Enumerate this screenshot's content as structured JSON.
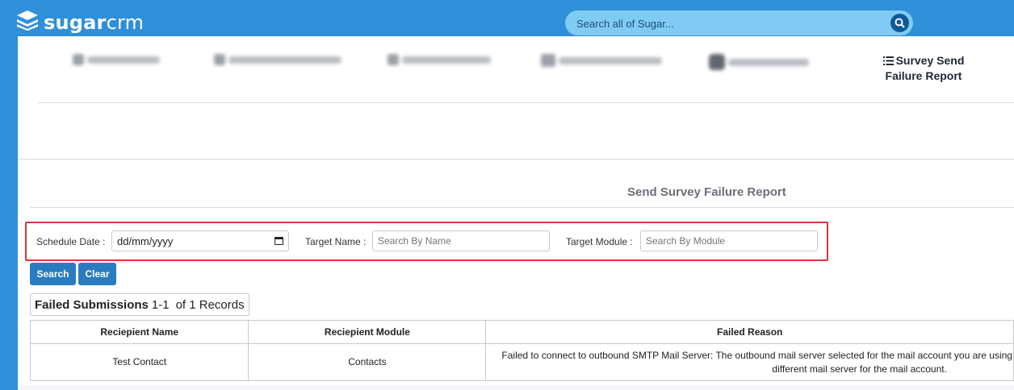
{
  "brand": {
    "bold": "sugar",
    "light": "crm"
  },
  "global_search": {
    "placeholder": "Search all of Sugar..."
  },
  "tabs": {
    "active": "Survey Send Failure Report"
  },
  "report": {
    "title": "Send Survey Failure Report"
  },
  "filters": {
    "schedule_date_label": "Schedule Date :",
    "schedule_date_placeholder": "dd/mm/yyyy",
    "target_name_label": "Target Name :",
    "target_name_placeholder": "Search By Name",
    "target_module_label": "Target Module :",
    "target_module_placeholder": "Search By Module"
  },
  "buttons": {
    "search": "Search",
    "clear": "Clear"
  },
  "summary": {
    "title": "Failed Submissions",
    "range": "1-1",
    "of_text": "of 1 Records"
  },
  "table": {
    "headers": [
      "Reciepient Name",
      "Reciepient Module",
      "Failed Reason"
    ],
    "rows": [
      {
        "name": "Test Contact",
        "module": "Contacts",
        "reason_line1": "Failed to connect to outbound SMTP Mail Server: The outbound mail server selected for the mail account you are using",
        "reason_line2": "different mail server for the mail account."
      }
    ]
  },
  "colors": {
    "header": "#2f8fd8",
    "button": "#2a7cc1",
    "highlight": "#e0333c"
  },
  "icons": {
    "search": "search-icon",
    "list": "list-icon",
    "calendar": "calendar-icon",
    "logo": "stack-logo-icon"
  }
}
